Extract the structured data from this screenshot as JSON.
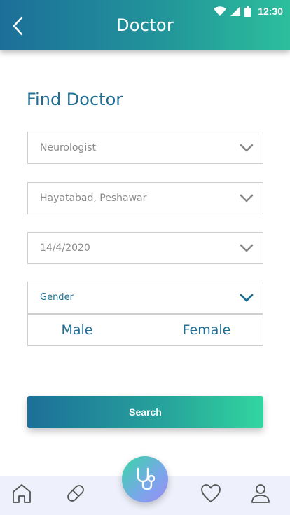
{
  "status_bar": {
    "time": "12:30"
  },
  "app_bar": {
    "title": "Doctor"
  },
  "form": {
    "heading": "Find Doctor",
    "specialty": "Neurologist",
    "location": "Hayatabad, Peshawar",
    "date": "14/4/2020",
    "gender": {
      "label": "Gender",
      "options": [
        "Male",
        "Female"
      ]
    },
    "search_label": "Search"
  },
  "bottom_nav": [
    "home-icon",
    "pill-icon",
    "stethoscope-icon",
    "heart-icon",
    "profile-icon"
  ],
  "colors": {
    "primary": "#1f6f94",
    "gradient_start": "#1c6f99",
    "gradient_end": "#31d6a0",
    "nav_background": "#eef0fb"
  }
}
